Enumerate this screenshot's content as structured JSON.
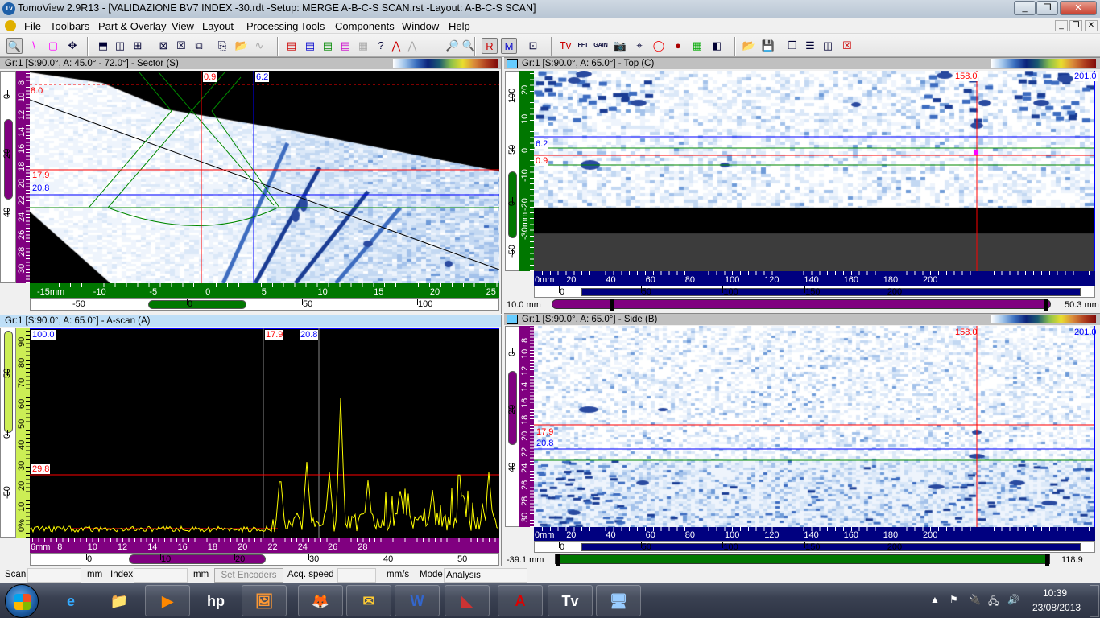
{
  "window": {
    "title": "TomoView 2.9R13 - [VALIDAZIONE BV7 INDEX -30.rdt -Setup: MERGE A-B-C-S SCAN.rst -Layout: A-B-C-S SCAN]",
    "app_icon": "Tv",
    "minimize": "_",
    "restore": "❐",
    "close": "✕"
  },
  "menu": {
    "items": [
      "File",
      "Toolbars",
      "Part & Overlay",
      "View",
      "Layout",
      "Processing",
      "Tools",
      "Components",
      "Window",
      "Help"
    ],
    "mdi_min": "_",
    "mdi_restore": "❐",
    "mdi_close": "✕"
  },
  "toolbar": {
    "icons": [
      "zoom-icon",
      "line-icon",
      "select-rect-icon",
      "pointer-icon",
      "layout-horizontal-icon",
      "layout-vertical-icon",
      "layout-quad-icon",
      "delete-view-icon",
      "close-view-icon",
      "move-view-icon",
      "view-properties-icon",
      "open-folder-icon",
      "signal-icon",
      "table-1-icon",
      "table-2-icon",
      "table-3-icon",
      "table-4-icon",
      "table-disabled-icon",
      "table-help-icon",
      "peak-red-icon",
      "peak-gray-icon",
      "zoom-in-icon",
      "zoom-color-icon",
      "reference-cursor-icon",
      "measure-cursor-icon",
      "export-icon",
      "tv-icon",
      "fft-icon",
      "gain-icon",
      "camera-icon",
      "cursor-icon",
      "color-wheel-icon",
      "palette-icon",
      "add-table-icon",
      "contrast-icon",
      "open-file-icon",
      "save-icon",
      "cascade-icon",
      "tile-horizontal-icon",
      "tile-vertical-icon",
      "close-all-icon"
    ],
    "glyphs": [
      "🔍",
      "\\",
      "▢",
      "✥",
      "⬒",
      "◫",
      "⊞",
      "⊠",
      "☒",
      "⧉",
      "⎘",
      "📂",
      "∿",
      "▤",
      "▤",
      "▤",
      "▤",
      "▦",
      "?",
      "⋀",
      "⋀",
      "🔎",
      "🔍",
      "R",
      "M",
      "⊡",
      "Tv",
      "FFT",
      "GAIN",
      "📷",
      "⌖",
      "◯",
      "●",
      "▦",
      "◧",
      "📂",
      "💾",
      "❐",
      "☰",
      "◫",
      "☒"
    ],
    "labels": {
      "reference": "R",
      "measure": "M",
      "fft": "FFT",
      "gain": "GAIN"
    }
  },
  "panels": {
    "sector": {
      "header": "Gr:1 [S:90.0°, A: 45.0° - 72.0°] - Sector (S)",
      "cursors": {
        "ref_index": "0.9",
        "meas_index": "6.2",
        "top": "8.0",
        "ref_depth": "17.9",
        "meas_depth": "20.8"
      },
      "vruler": [
        "8",
        "10",
        "12",
        "14",
        "16",
        "18",
        "20",
        "22",
        "24",
        "26",
        "28",
        "30"
      ],
      "vscale": [
        "0",
        "20",
        "40"
      ],
      "hruler": [
        "-15mm",
        "-10",
        "-5",
        "0",
        "5",
        "10",
        "15",
        "20",
        "25"
      ],
      "hscale": [
        "-50",
        "0",
        "50",
        "100"
      ]
    },
    "ascan": {
      "header": "Gr:1 [S:90.0°, A: 65.0°] - A-scan (A)",
      "cursors": {
        "amplitude_top": "100.0",
        "ref_depth": "17.9",
        "meas_depth": "20.8",
        "gate": "29.8"
      },
      "vruler": [
        "90",
        "80",
        "70",
        "60",
        "50",
        "40",
        "30",
        "20",
        "10",
        "0%"
      ],
      "vscale": [
        "50",
        "0",
        "-50",
        "-100"
      ],
      "hruler": [
        "6mm",
        "8",
        "10",
        "12",
        "14",
        "16",
        "18",
        "20",
        "22",
        "24",
        "26",
        "28"
      ],
      "hscale": [
        "0",
        "10",
        "20",
        "30",
        "40",
        "50"
      ]
    },
    "top": {
      "header": "Gr:1 [S:90.0°, A: 65.0°] - Top (C)",
      "cursors": {
        "ref_scan": "158.0",
        "scan_end": "201.0",
        "meas_index": "6.2",
        "ref_index": "0.9"
      },
      "vruler": [
        "20",
        "10",
        "0",
        "-10",
        "-20",
        "-30mm"
      ],
      "vscale": [
        "100",
        "50",
        "0",
        "-50"
      ],
      "hruler": [
        "0mm",
        "20",
        "40",
        "60",
        "80",
        "100",
        "120",
        "140",
        "160",
        "180",
        "200"
      ],
      "hscale": [
        "0",
        "50",
        "100",
        "150",
        "200"
      ],
      "slider": {
        "min_label": "10.0 mm",
        "max_label": "50.3 mm"
      }
    },
    "side": {
      "header": "Gr:1 [S:90.0°, A: 65.0°] - Side (B)",
      "cursors": {
        "ref_scan": "158.0",
        "scan_end": "201.0",
        "ref_depth": "17.9",
        "meas_depth": "20.8"
      },
      "vruler": [
        "8",
        "10",
        "12",
        "14",
        "16",
        "18",
        "20",
        "22",
        "24",
        "26",
        "28",
        "30"
      ],
      "vscale": [
        "0",
        "20",
        "40"
      ],
      "hruler": [
        "0mm",
        "20",
        "40",
        "60",
        "80",
        "100",
        "120",
        "140",
        "160",
        "180",
        "200"
      ],
      "hscale": [
        "0",
        "50",
        "100",
        "150",
        "200"
      ],
      "slider": {
        "min_label": "-39.1 mm",
        "max_label": "118.9 mm"
      }
    }
  },
  "colors": {
    "sector_ruler": "#800080",
    "ascan_ruler": "#ccee55",
    "top_ruler": "#007700",
    "scan_ruler": "#000080",
    "reference": "#ff0000",
    "measure": "#0000ff",
    "gate": "#008800",
    "signal": "#ffff00"
  },
  "status": {
    "scan_label": "Scan",
    "scan_unit": "mm",
    "index_label": "Index",
    "index_unit": "mm",
    "set_encoders": "Set Encoders",
    "acq_label": "Acq. speed",
    "acq_unit": "mm/s",
    "mode_label": "Mode",
    "mode_value": "Analysis"
  },
  "taskbar": {
    "apps": [
      "internet-explorer",
      "file-explorer",
      "media-player",
      "hp",
      "photo-gallery",
      "firefox",
      "outlook",
      "word",
      "setup-tool",
      "acrobat",
      "tomoview",
      "remote-desktop"
    ],
    "glyphs": [
      "e",
      "📁",
      "▶",
      "hp",
      "🖼",
      "🦊",
      "✉",
      "W",
      "◣",
      "A",
      "Tv",
      "🖥"
    ],
    "tray": [
      "▲",
      "⚑",
      "🔌",
      "🖧",
      "🔊"
    ],
    "time": "10:39",
    "date": "23/08/2013"
  }
}
